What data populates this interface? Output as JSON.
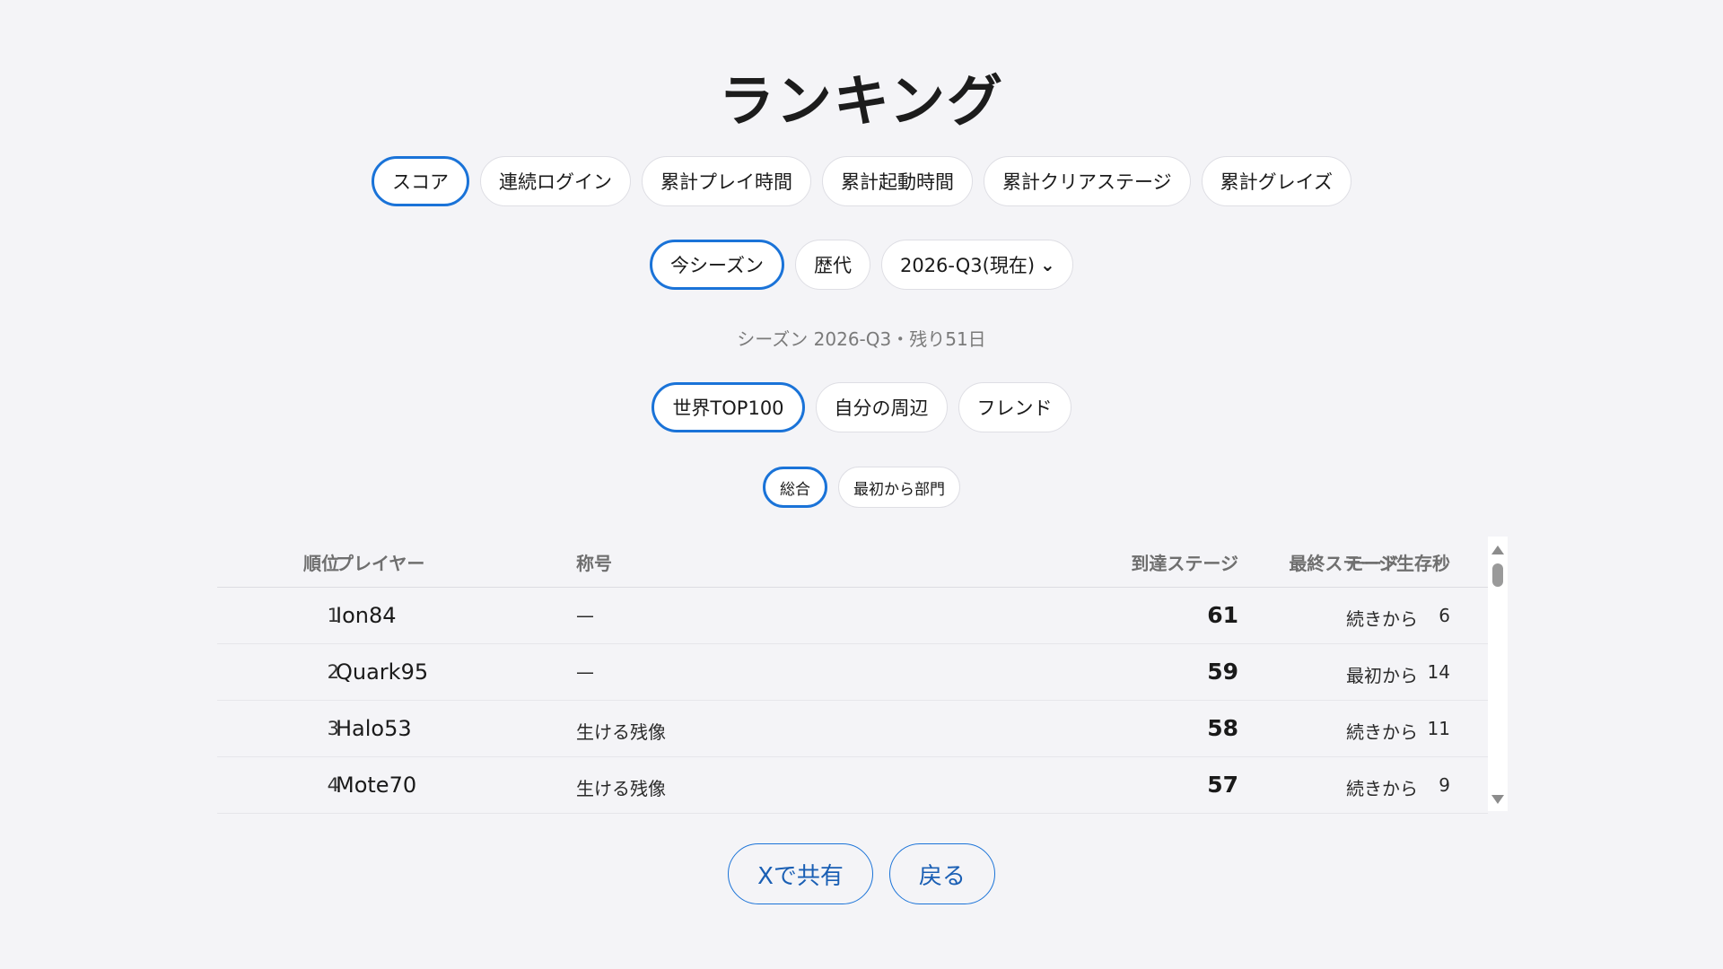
{
  "page": {
    "title": "ランキング"
  },
  "category_tabs": [
    {
      "label": "スコア",
      "active": true
    },
    {
      "label": "連続ログイン",
      "active": false
    },
    {
      "label": "累計プレイ時間",
      "active": false
    },
    {
      "label": "累計起動時間",
      "active": false
    },
    {
      "label": "累計クリアステージ",
      "active": false
    },
    {
      "label": "累計グレイズ",
      "active": false
    }
  ],
  "season_tabs": [
    {
      "label": "今シーズン",
      "active": true
    },
    {
      "label": "歴代",
      "active": false
    }
  ],
  "season_select": {
    "value": "2026-Q3(現在)",
    "chevron_icon": "chevron-down-icon"
  },
  "season_info": "シーズン 2026-Q3・残り51日",
  "scope_tabs": [
    {
      "label": "世界TOP100",
      "active": true
    },
    {
      "label": "自分の周辺",
      "active": false
    },
    {
      "label": "フレンド",
      "active": false
    }
  ],
  "division_tabs": [
    {
      "label": "総合",
      "active": true
    },
    {
      "label": "最初から部門",
      "active": false
    }
  ],
  "table": {
    "headers": {
      "rank": "順位",
      "player": "プレイヤー",
      "title": "称号",
      "stage": "到達ステージ",
      "seconds": "最終ステージ生存秒",
      "mode": "モード"
    },
    "rows": [
      {
        "rank": "1",
        "player": "Ion84",
        "title": "—",
        "stage": "61",
        "seconds": "6",
        "mode": "続きから"
      },
      {
        "rank": "2",
        "player": "Quark95",
        "title": "—",
        "stage": "59",
        "seconds": "14",
        "mode": "最初から"
      },
      {
        "rank": "3",
        "player": "Halo53",
        "title": "生ける残像",
        "stage": "58",
        "seconds": "11",
        "mode": "続きから"
      },
      {
        "rank": "4",
        "player": "Mote70",
        "title": "生ける残像",
        "stage": "57",
        "seconds": "9",
        "mode": "続きから"
      }
    ]
  },
  "actions": {
    "share_label": "Xで共有",
    "back_label": "戻る"
  },
  "colors": {
    "background": "#f4f4f7",
    "accent": "#1a73d8",
    "muted_text": "#7a7a7a"
  }
}
